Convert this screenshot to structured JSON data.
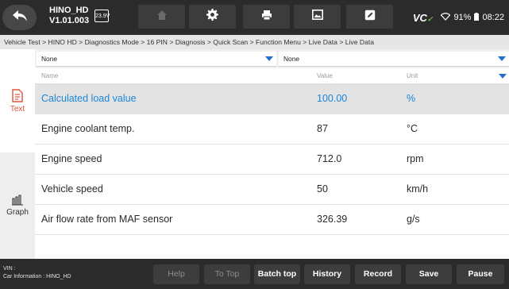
{
  "header": {
    "title": "HINO_HD",
    "version": "V1.01.003",
    "voltage": "23.9V",
    "vci_label": "VC",
    "battery": "91%",
    "time": "08:22",
    "icons": [
      "back-icon",
      "home-icon",
      "settings-icon",
      "print-icon",
      "image-icon",
      "edit-icon",
      "wifi-icon",
      "battery-icon"
    ]
  },
  "breadcrumb": "Vehicle Test > HINO HD > Diagnostics Mode > 16 PIN > Diagnosis > Quick Scan > Function Menu > Live Data > Live Data",
  "sidebar": {
    "text_label": "Text",
    "graph_label": "Graph"
  },
  "selectors": {
    "left": "None",
    "right": "None"
  },
  "table": {
    "columns": {
      "name": "Name",
      "value": "Value",
      "unit": "Unit"
    },
    "rows": [
      {
        "name": "Calculated load value",
        "value": "100.00",
        "unit": "%",
        "selected": true
      },
      {
        "name": "Engine coolant temp.",
        "value": "87",
        "unit": "°C",
        "selected": false
      },
      {
        "name": "Engine speed",
        "value": "712.0",
        "unit": "rpm",
        "selected": false
      },
      {
        "name": "Vehicle speed",
        "value": "50",
        "unit": "km/h",
        "selected": false
      },
      {
        "name": "Air flow rate from MAF sensor",
        "value": "326.39",
        "unit": "g/s",
        "selected": false
      }
    ]
  },
  "footer": {
    "vin_label": "VIN :",
    "car_info": "Car Information : HINO_HD",
    "buttons": {
      "help": "Help",
      "to_top": "To Top",
      "batch_top": "Batch top",
      "history": "History",
      "record": "Record",
      "save": "Save",
      "pause": "Pause"
    }
  }
}
